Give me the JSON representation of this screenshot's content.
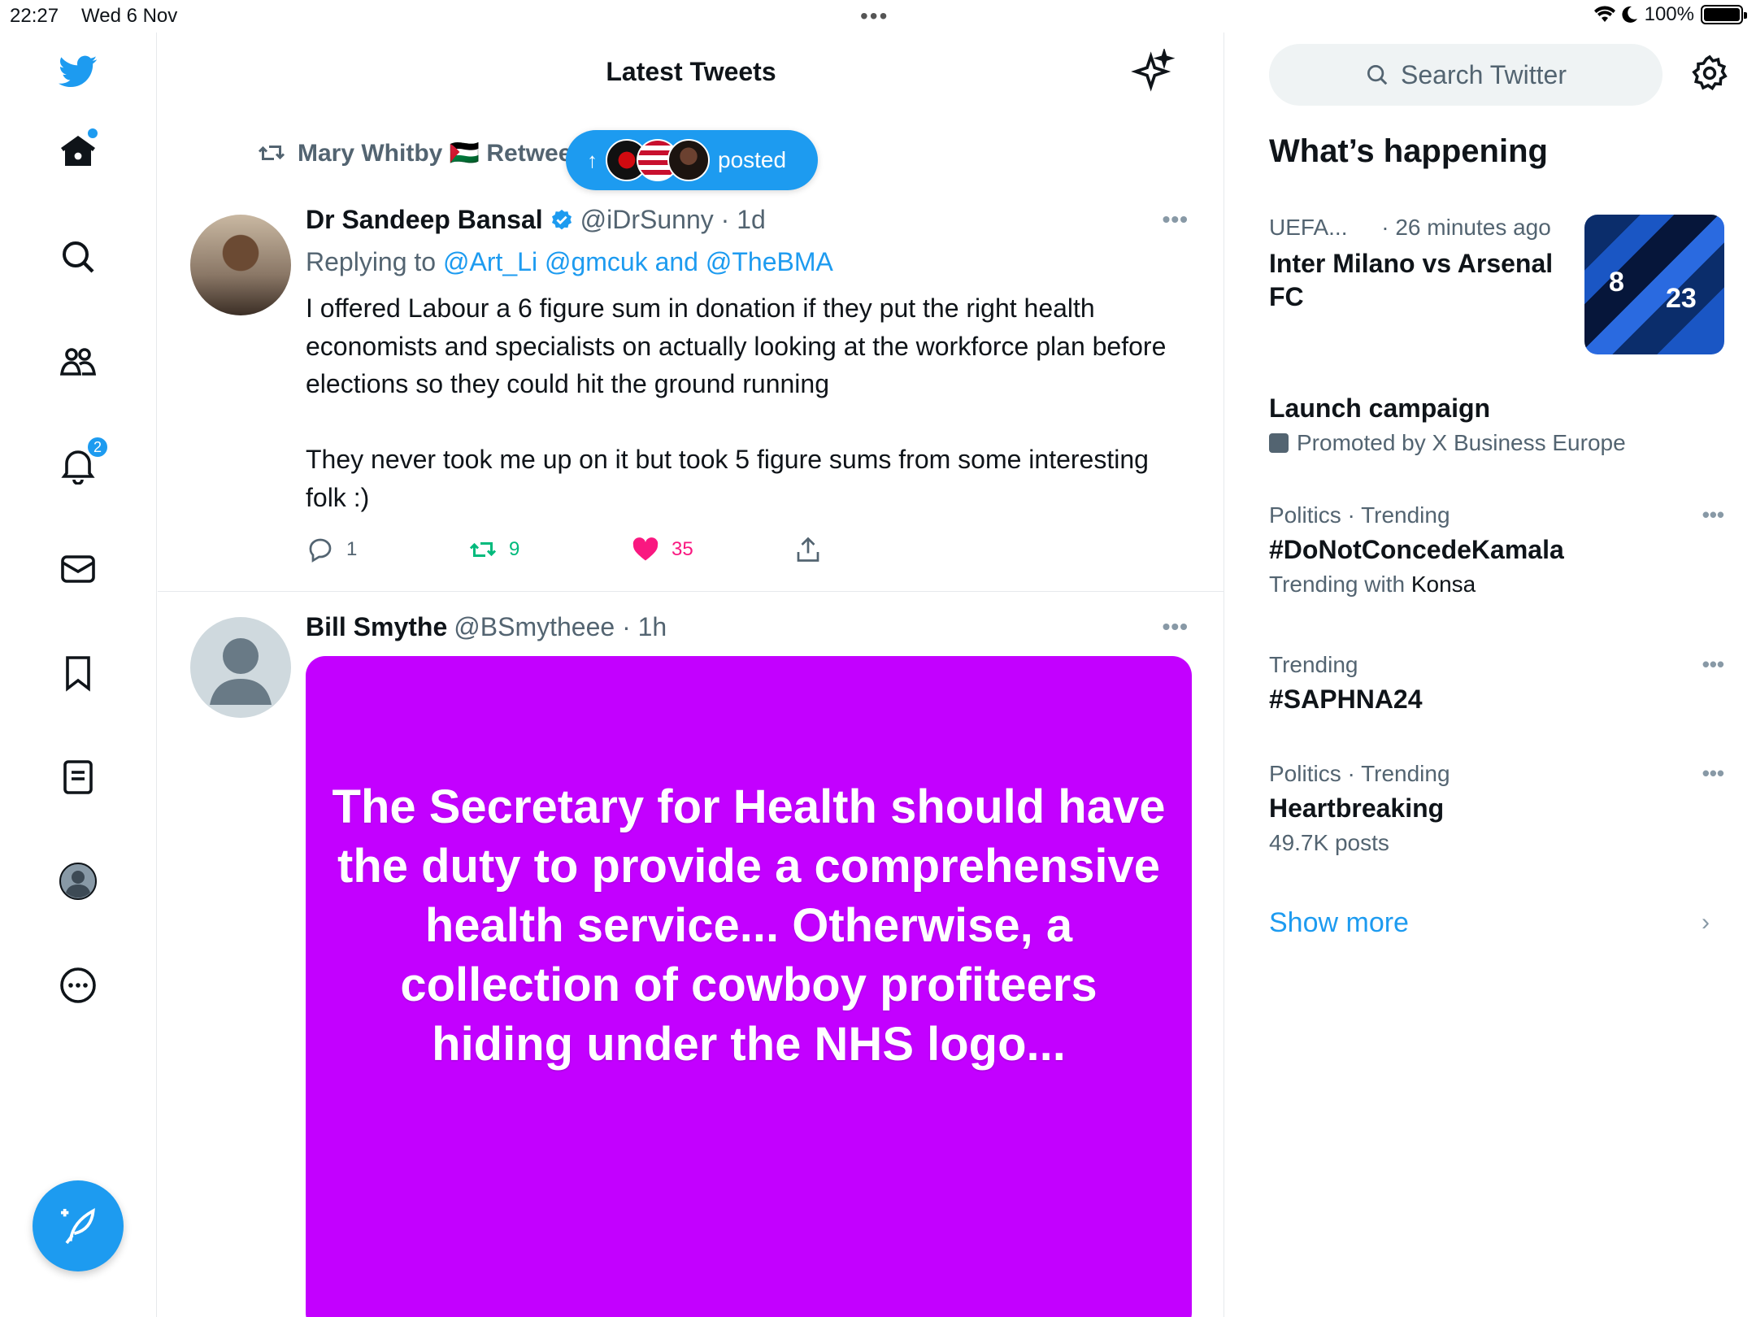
{
  "status_bar": {
    "time": "22:27",
    "date": "Wed 6 Nov",
    "battery": "100%"
  },
  "colors": {
    "accent": "#1d9bf0",
    "retweet_green": "#00ba7c",
    "like_pink": "#f91880",
    "media_bg": "#c300ff",
    "muted_text": "#536471"
  },
  "nav": {
    "items": [
      {
        "name": "twitter-logo-icon"
      },
      {
        "name": "home-icon"
      },
      {
        "name": "search-icon"
      },
      {
        "name": "communities-icon"
      },
      {
        "name": "notifications-icon",
        "badge": "2"
      },
      {
        "name": "messages-icon"
      },
      {
        "name": "bookmarks-icon"
      },
      {
        "name": "lists-icon"
      },
      {
        "name": "profile-avatar-icon"
      },
      {
        "name": "more-icon"
      }
    ],
    "compose_icon": "compose-feather-icon"
  },
  "main": {
    "title": "Latest Tweets",
    "new_posts_pill": {
      "label": "posted"
    },
    "tweets": [
      {
        "retweeted_by": "Mary Whitby 🇵🇸 Retweeted",
        "name": "Dr Sandeep Bansal",
        "verified": true,
        "handle": "@iDrSunny · 1d",
        "replying_prefix": "Replying to",
        "replying_to": "@Art_Li @gmcuk and @TheBMA",
        "text": "I offered Labour a 6 figure sum in donation if they put the right health economists and specialists on actually looking at the workforce plan before elections so they could hit the ground running\n\nThey never took me up on it but took 5 figure sums from some interesting folk :)",
        "replies": "1",
        "retweets": "9",
        "likes": "35"
      },
      {
        "name": "Bill Smythe",
        "handle": "@BSmytheee · 1h",
        "image_text": "The Secretary for Health should have the duty to provide a comprehensive health service... Otherwise, a collection of cowboy profiteers hiding under the NHS logo..."
      }
    ]
  },
  "sidebar": {
    "search_placeholder": "Search Twitter",
    "section_title": "What’s happening",
    "trends": [
      {
        "meta": "UEFA...",
        "time": "· 26 minutes ago",
        "topic": "Inter Milano vs Arsenal FC"
      },
      {
        "topic": "Launch campaign",
        "sub": "Promoted by X Business Europe"
      },
      {
        "meta": "Politics · Trending",
        "topic": "#DoNotConcedeKamala",
        "sub_prefix": "Trending with",
        "sub_highlight": "Konsa"
      },
      {
        "meta": "Trending",
        "topic": "#SAPHNA24"
      },
      {
        "meta": "Politics · Trending",
        "topic": "Heartbreaking",
        "sub": "49.7K posts"
      }
    ],
    "show_more": "Show more"
  }
}
